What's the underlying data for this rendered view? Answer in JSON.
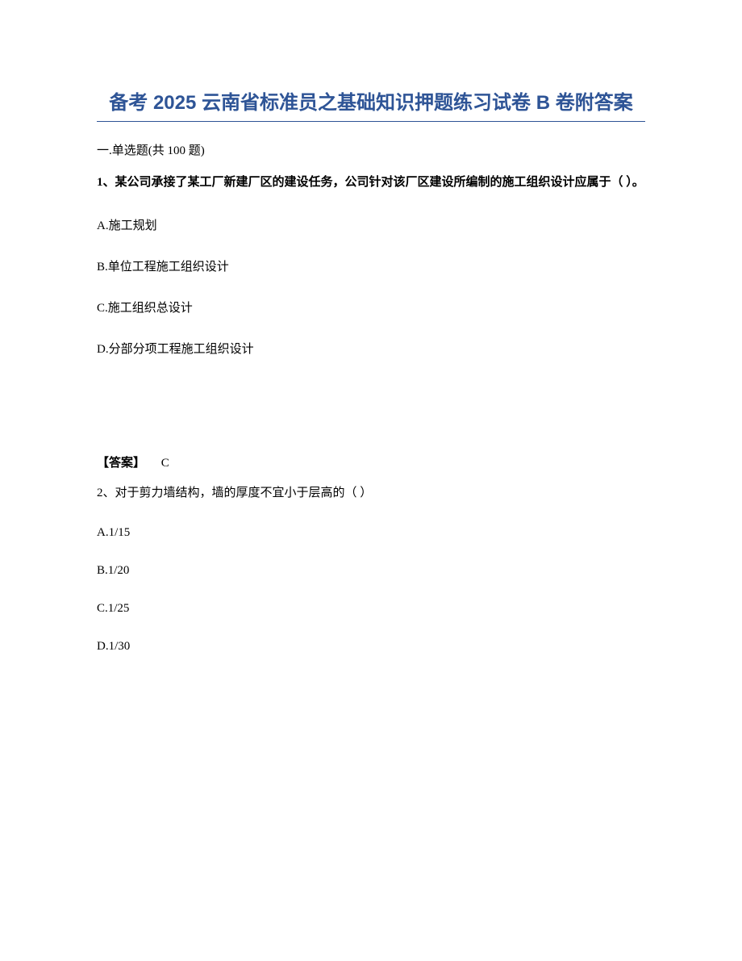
{
  "title": "备考 2025 云南省标准员之基础知识押题练习试卷 B 卷附答案",
  "section_header": "一.单选题(共 100 题)",
  "q1": {
    "stem": "1、某公司承接了某工厂新建厂区的建设任务，公司针对该厂区建设所编制的施工组织设计应属于（ ）。",
    "A": "A.施工规划",
    "B": "B.单位工程施工组织设计",
    "C": "C.施工组织总设计",
    "D": "D.分部分项工程施工组织设计",
    "answer_label": "【答案】",
    "answer_value": "C"
  },
  "q2": {
    "stem": "2、对于剪力墙结构，墙的厚度不宜小于层高的（ ）",
    "A": "A.1/15",
    "B": "B.1/20",
    "C": "C.1/25",
    "D": "D.1/30"
  }
}
